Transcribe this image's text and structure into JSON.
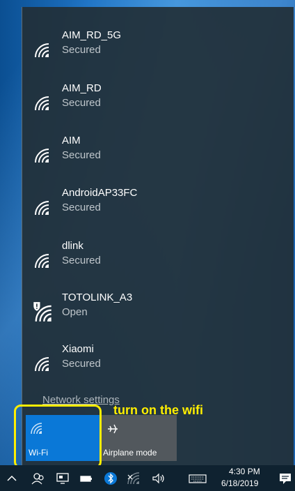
{
  "networks": [
    {
      "name": "AIM_RD_5G",
      "status": "Secured",
      "icon": "wifi-icon"
    },
    {
      "name": "AIM_RD",
      "status": "Secured",
      "icon": "wifi-icon"
    },
    {
      "name": "AIM",
      "status": "Secured",
      "icon": "wifi-icon"
    },
    {
      "name": "AndroidAP33FC",
      "status": "Secured",
      "icon": "wifi-icon"
    },
    {
      "name": "dlink",
      "status": "Secured",
      "icon": "wifi-icon"
    },
    {
      "name": "TOTOLINK_A3",
      "status": "Open",
      "icon": "wifi-open-shield-icon"
    },
    {
      "name": "Xiaomi",
      "status": "Secured",
      "icon": "wifi-icon"
    }
  ],
  "network_settings_label": "Network settings",
  "tiles": {
    "wifi": {
      "label": "Wi-Fi",
      "icon": "wifi-icon"
    },
    "airplane": {
      "label": "Airplane mode",
      "icon": "airplane-icon"
    }
  },
  "annotation_text": "turn on the wifi",
  "taskbar": {
    "time": "4:30 PM",
    "date": "6/18/2019",
    "icons": [
      "chevron-up-icon",
      "people-icon",
      "network-monitor-icon",
      "battery-icon",
      "bluetooth-icon",
      "wifi-icon",
      "volume-icon",
      "keyboard-icon",
      "notification-icon"
    ]
  },
  "colors": {
    "accent": "#0a78d7",
    "flyout_bg": "#212f38",
    "annotation": "#ffee00",
    "taskbar": "#0f2230"
  }
}
